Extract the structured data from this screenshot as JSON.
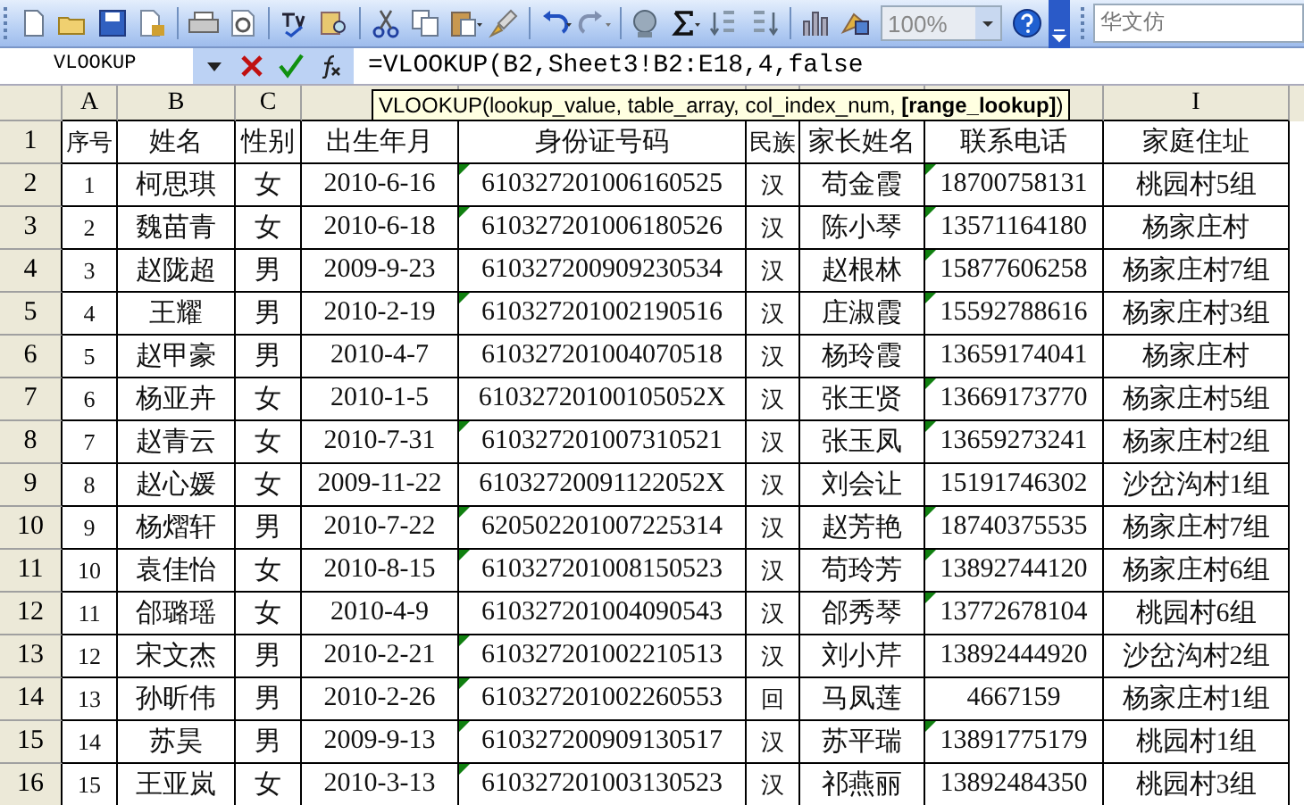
{
  "toolbar": {
    "zoom": "100%",
    "font": "华文仿"
  },
  "formula_bar": {
    "name_box": "VLOOKUP",
    "formula": "=VLOOKUP(B2,Sheet3!B2:E18,4,false"
  },
  "tooltip": "VLOOKUP(lookup_value, table_array, col_index_num, **[range_lookup]**)",
  "sheet": {
    "columns": [
      {
        "label": "A"
      },
      {
        "label": "B"
      },
      {
        "label": "C"
      },
      {},
      {},
      {},
      {},
      {},
      {
        "label": "I"
      }
    ],
    "rows": [
      {
        "number": "1",
        "cells": [
          "序号",
          "姓名",
          "性别",
          "出生年月",
          "身份证号码",
          "民族",
          "家长姓名",
          "联系电话",
          "家庭住址"
        ],
        "id_flag": false,
        "phone_flag": false
      },
      {
        "number": "2",
        "cells": [
          "1",
          "柯思琪",
          "女",
          "2010-6-16",
          "610327201006160525",
          "汉",
          "苟金霞",
          "18700758131",
          "桃园村5组"
        ],
        "id_flag": true,
        "phone_flag": true
      },
      {
        "number": "3",
        "cells": [
          "2",
          "魏苗青",
          "女",
          "2010-6-18",
          "610327201006180526",
          "汉",
          "陈小琴",
          "13571164180",
          "杨家庄村"
        ],
        "id_flag": true,
        "phone_flag": true
      },
      {
        "number": "4",
        "cells": [
          "3",
          "赵陇超",
          "男",
          "2009-9-23",
          "610327200909230534",
          "汉",
          "赵根林",
          "15877606258",
          "杨家庄村7组"
        ],
        "id_flag": false,
        "phone_flag": true
      },
      {
        "number": "5",
        "cells": [
          "4",
          "王耀",
          "男",
          "2010-2-19",
          "610327201002190516",
          "汉",
          "庄淑霞",
          "15592788616",
          "杨家庄村3组"
        ],
        "id_flag": true,
        "phone_flag": true
      },
      {
        "number": "6",
        "cells": [
          "5",
          "赵甲豪",
          "男",
          "2010-4-7",
          "610327201004070518",
          "汉",
          "杨玲霞",
          "13659174041",
          "杨家庄村"
        ],
        "id_flag": false,
        "phone_flag": false
      },
      {
        "number": "7",
        "cells": [
          "6",
          "杨亚卉",
          "女",
          "2010-1-5",
          "61032720100105052X",
          "汉",
          "张王贤",
          "13669173770",
          "杨家庄村5组"
        ],
        "id_flag": false,
        "phone_flag": true
      },
      {
        "number": "8",
        "cells": [
          "7",
          "赵青云",
          "女",
          "2010-7-31",
          "610327201007310521",
          "汉",
          "张玉凤",
          "13659273241",
          "杨家庄村2组"
        ],
        "id_flag": true,
        "phone_flag": true
      },
      {
        "number": "9",
        "cells": [
          "8",
          "赵心媛",
          "女",
          "2009-11-22",
          "61032720091122052X",
          "汉",
          "刘会让",
          "15191746302",
          "沙岔沟村1组"
        ],
        "id_flag": false,
        "phone_flag": false
      },
      {
        "number": "10",
        "cells": [
          "9",
          "杨熠轩",
          "男",
          "2010-7-22",
          "620502201007225314",
          "汉",
          "赵芳艳",
          "18740375535",
          "杨家庄村7组"
        ],
        "id_flag": true,
        "phone_flag": true
      },
      {
        "number": "11",
        "cells": [
          "10",
          "袁佳怡",
          "女",
          "2010-8-15",
          "610327201008150523",
          "汉",
          "苟玲芳",
          "13892744120",
          "杨家庄村6组"
        ],
        "id_flag": true,
        "phone_flag": true
      },
      {
        "number": "12",
        "cells": [
          "11",
          "郃璐瑶",
          "女",
          "2010-4-9",
          "610327201004090543",
          "汉",
          "郃秀琴",
          "13772678104",
          "桃园村6组"
        ],
        "id_flag": false,
        "phone_flag": true
      },
      {
        "number": "13",
        "cells": [
          "12",
          "宋文杰",
          "男",
          "2010-2-21",
          "610327201002210513",
          "汉",
          "刘小芹",
          "13892444920",
          "沙岔沟村2组"
        ],
        "id_flag": true,
        "phone_flag": false
      },
      {
        "number": "14",
        "cells": [
          "13",
          "孙昕伟",
          "男",
          "2010-2-26",
          "610327201002260553",
          "回",
          "马凤莲",
          "4667159",
          "杨家庄村1组"
        ],
        "id_flag": true,
        "phone_flag": false
      },
      {
        "number": "15",
        "cells": [
          "14",
          "苏昊",
          "男",
          "2009-9-13",
          "610327200909130517",
          "汉",
          "苏平瑞",
          "13891775179",
          "桃园村1组"
        ],
        "id_flag": true,
        "phone_flag": true
      },
      {
        "number": "16",
        "cells": [
          "15",
          "王亚岚",
          "女",
          "2010-3-13",
          "610327201003130523",
          "汉",
          "祁燕丽",
          "13892484350",
          "桃园村3组"
        ],
        "id_flag": true,
        "phone_flag": false
      }
    ]
  }
}
